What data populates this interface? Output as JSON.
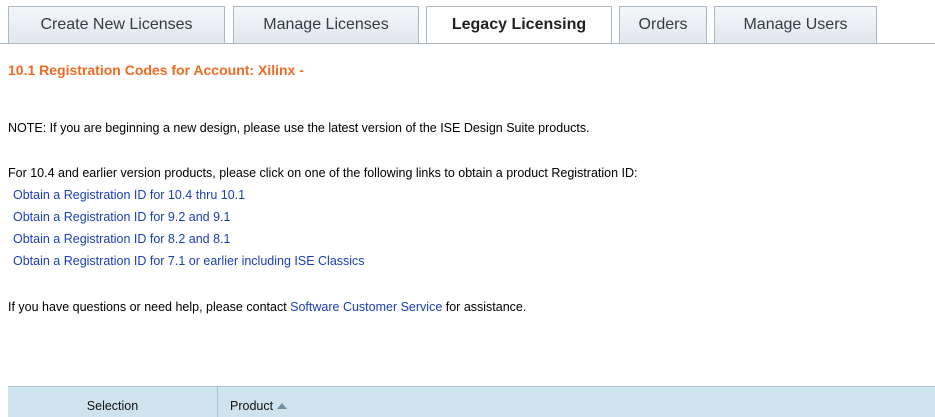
{
  "tabs": [
    {
      "label": "Create New Licenses",
      "active": false
    },
    {
      "label": "Manage Licenses",
      "active": false
    },
    {
      "label": "Legacy Licensing",
      "active": true
    },
    {
      "label": "Orders",
      "active": false
    },
    {
      "label": "Manage Users",
      "active": false
    }
  ],
  "heading": "10.1 Registration Codes for Account: Xilinx -",
  "note": "NOTE: If you are beginning a new design, please use the latest version of the ISE Design Suite products.",
  "intro": "For 10.4 and earlier version products, please click on one of the following links to obtain a product Registration ID:",
  "links": [
    "Obtain a Registration ID for 10.4 thru 10.1",
    "Obtain a Registration ID for 9.2 and 9.1",
    "Obtain a Registration ID for 8.2 and 8.1",
    "Obtain a Registration ID for 7.1 or earlier including ISE Classics"
  ],
  "help": {
    "prefix": "If you have questions or need help, please contact ",
    "link": "Software Customer Service",
    "suffix": " for assistance."
  },
  "table": {
    "columns": [
      "Selection",
      "Product"
    ],
    "sort_indicator": "ascending"
  },
  "colors": {
    "heading": "#ef6b24",
    "link": "#1a3fb8",
    "table_header_bg": "#cfe3ee"
  }
}
